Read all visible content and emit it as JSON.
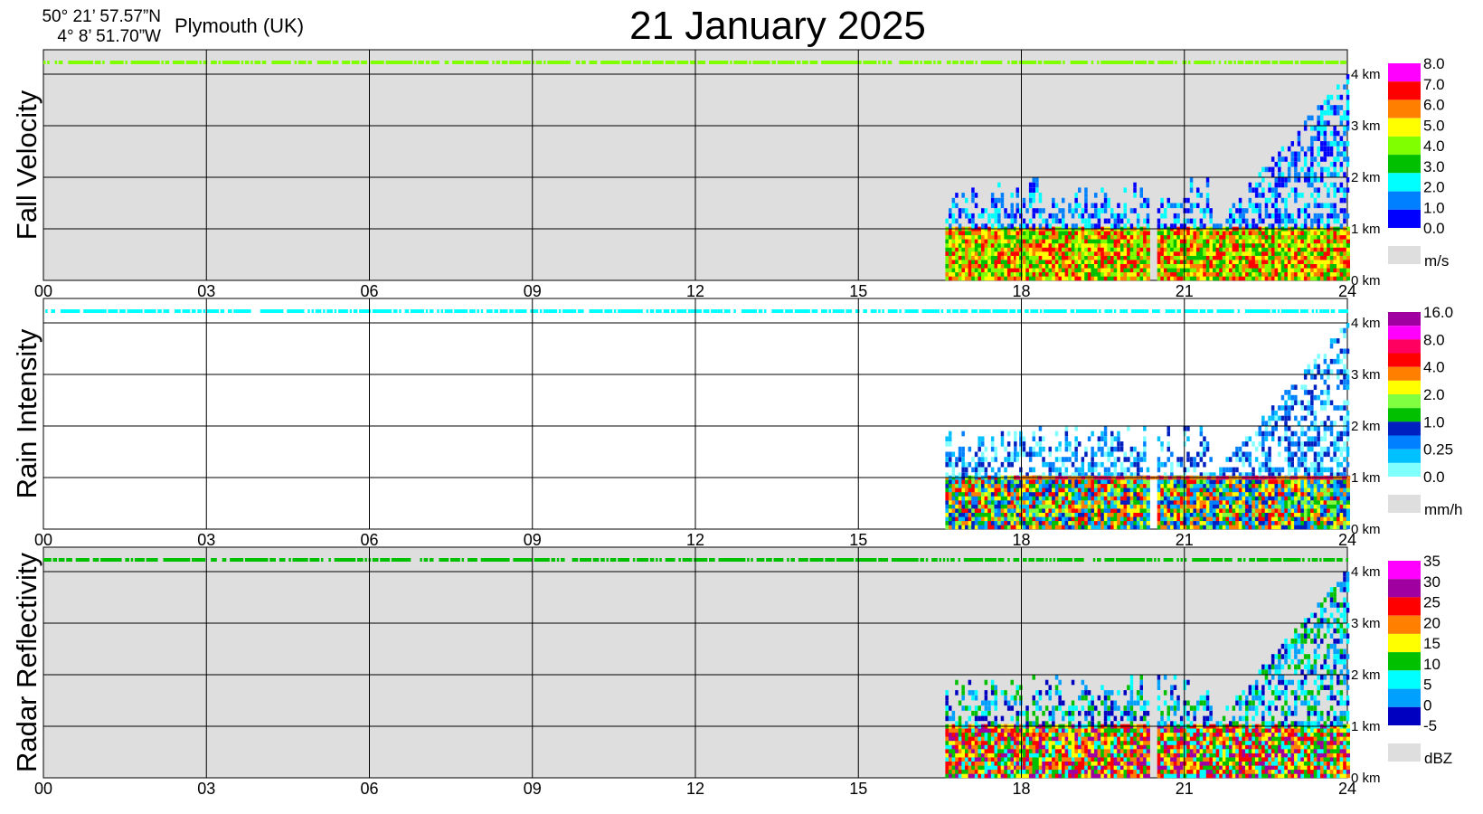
{
  "header": {
    "latitude": "50° 21’ 57.57”N",
    "longitude": "4°  8’ 51.70”W",
    "location": "Plymouth (UK)",
    "title": "21 January  2025"
  },
  "chart_data": [
    {
      "type": "heatmap",
      "ylabel": "Fall Velocity",
      "x_ticks": [
        "00",
        "03",
        "06",
        "09",
        "12",
        "15",
        "18",
        "21",
        "24"
      ],
      "y_ticks": [
        "0 km",
        "1 km",
        "2 km",
        "3 km",
        "4 km"
      ],
      "xlim": [
        0,
        24
      ],
      "ylim_km": [
        0,
        4.5
      ],
      "no_data_color": "#dedede",
      "legend": {
        "unit": "m/s",
        "labels": [
          "8.0",
          "7.0",
          "6.0",
          "5.0",
          "4.0",
          "3.0",
          "2.0",
          "1.0",
          "0.0"
        ],
        "colors": [
          "#ff00ff",
          "#ff0000",
          "#ff7f00",
          "#ffff00",
          "#80ff00",
          "#00c000",
          "#00ffff",
          "#0080ff",
          "#0000ff"
        ]
      },
      "features": [
        {
          "kind": "surface-band",
          "from_hour": 16.5,
          "to_hour": 24,
          "top_km": 1.0,
          "dominant_values": "3.0–7.0"
        },
        {
          "kind": "aloft-echo",
          "from_hour": 16.5,
          "to_hour": 24,
          "top_km": 4.1,
          "dominant_values": "0.0–2.0"
        }
      ]
    },
    {
      "type": "heatmap",
      "ylabel": "Rain Intensity",
      "x_ticks": [
        "00",
        "03",
        "06",
        "09",
        "12",
        "15",
        "18",
        "21",
        "24"
      ],
      "y_ticks": [
        "0 km",
        "1 km",
        "2 km",
        "3 km",
        "4 km"
      ],
      "xlim": [
        0,
        24
      ],
      "ylim_km": [
        0,
        4.5
      ],
      "no_data_color": "#ffffff",
      "legend": {
        "unit": "mm/h",
        "labels": [
          "16.0",
          "8.0",
          "4.0",
          "2.0",
          "1.0",
          "0.25",
          "0.0"
        ],
        "colors": [
          "#a000a0",
          "#ff00ff",
          "#ff0060",
          "#ff0000",
          "#ff8000",
          "#ffff00",
          "#80ff40",
          "#00c000",
          "#0020c0",
          "#0080ff",
          "#00c0ff",
          "#80ffff"
        ]
      },
      "features": [
        {
          "kind": "melting-layer",
          "height_km": 1.0,
          "from_hour": 17,
          "to_hour": 24,
          "dominant_values": "4.0–16.0"
        },
        {
          "kind": "surface-band",
          "from_hour": 16.5,
          "to_hour": 24,
          "top_km": 1.0,
          "dominant_values": "0.25–8.0"
        }
      ]
    },
    {
      "type": "heatmap",
      "ylabel": "Radar Reflectivity",
      "x_ticks": [
        "00",
        "03",
        "06",
        "09",
        "12",
        "15",
        "18",
        "21",
        "24"
      ],
      "y_ticks": [
        "0 km",
        "1 km",
        "2 km",
        "3 km",
        "4 km"
      ],
      "xlim": [
        0,
        24
      ],
      "ylim_km": [
        0,
        4.5
      ],
      "no_data_color": "#dedede",
      "legend": {
        "unit": "dBZ",
        "labels": [
          "35",
          "30",
          "25",
          "20",
          "15",
          "10",
          "5",
          "0",
          "-5"
        ],
        "colors": [
          "#ff00ff",
          "#a000a0",
          "#ff0000",
          "#ff7f00",
          "#ffff00",
          "#00c000",
          "#00ffff",
          "#00a0ff",
          "#0000c0"
        ]
      },
      "features": [
        {
          "kind": "surface-band",
          "from_hour": 16.5,
          "to_hour": 24,
          "top_km": 1.0,
          "dominant_values": "10–30"
        },
        {
          "kind": "aloft-echo",
          "from_hour": 16.5,
          "to_hour": 24,
          "top_km": 4.1,
          "dominant_values": "-5–15"
        }
      ]
    }
  ]
}
